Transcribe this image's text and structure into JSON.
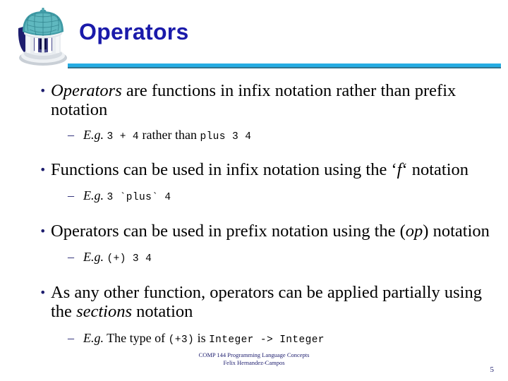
{
  "slide": {
    "title": "Operators",
    "logo_name": "old-well-rotunda-logo",
    "accent_color": "#25ace3",
    "title_color": "#1a1aaa",
    "bullet_color": "#1d1d6e",
    "background": "#ffffff"
  },
  "bullets": [
    {
      "id": "bullet-1",
      "marker": "•",
      "parts": [
        {
          "text": "Operators",
          "style": "italic"
        },
        {
          "text": " are functions in infix notation rather than prefix notation",
          "style": "normal"
        }
      ],
      "sub": {
        "id": "sub-bullet-1",
        "marker": "–",
        "parts": [
          {
            "text": "E.g.",
            "style": "italic"
          },
          {
            "text": " ",
            "style": "normal"
          },
          {
            "text": "3 + 4",
            "style": "mono"
          },
          {
            "text": " rather than ",
            "style": "normal"
          },
          {
            "text": "plus 3 4",
            "style": "mono"
          }
        ]
      }
    },
    {
      "id": "bullet-2",
      "marker": "•",
      "parts": [
        {
          "text": "Functions can be used in infix notation using the ‘",
          "style": "normal"
        },
        {
          "text": "f",
          "style": "italic"
        },
        {
          "text": "‘ notation",
          "style": "normal"
        }
      ],
      "sub": {
        "id": "sub-bullet-2",
        "marker": "–",
        "parts": [
          {
            "text": "E.g.",
            "style": "italic"
          },
          {
            "text": " ",
            "style": "normal"
          },
          {
            "text": "3 `plus` 4",
            "style": "mono"
          }
        ]
      }
    },
    {
      "id": "bullet-3",
      "marker": "•",
      "parts": [
        {
          "text": "Operators can be used in prefix notation using the (",
          "style": "normal"
        },
        {
          "text": "op",
          "style": "italic"
        },
        {
          "text": ") notation",
          "style": "normal"
        }
      ],
      "sub": {
        "id": "sub-bullet-3",
        "marker": "–",
        "parts": [
          {
            "text": "E.g.",
            "style": "italic"
          },
          {
            "text": " ",
            "style": "normal"
          },
          {
            "text": "(+) 3 4",
            "style": "mono"
          }
        ]
      }
    },
    {
      "id": "bullet-4",
      "marker": "•",
      "parts": [
        {
          "text": "As any other function, operators can be applied partially using the ",
          "style": "normal"
        },
        {
          "text": "sections",
          "style": "italic"
        },
        {
          "text": " notation",
          "style": "normal"
        }
      ],
      "sub": {
        "id": "sub-bullet-4",
        "marker": "–",
        "parts": [
          {
            "text": "E.g.",
            "style": "italic"
          },
          {
            "text": " The type of ",
            "style": "normal"
          },
          {
            "text": "(+3)",
            "style": "mono"
          },
          {
            "text": " is ",
            "style": "normal"
          },
          {
            "text": "Integer -> Integer",
            "style": "mono"
          }
        ]
      }
    }
  ],
  "footer": {
    "line1": "COMP 144 Programming Language Concepts",
    "line2": "Felix Hernandez-Campos"
  },
  "page_number": "5"
}
